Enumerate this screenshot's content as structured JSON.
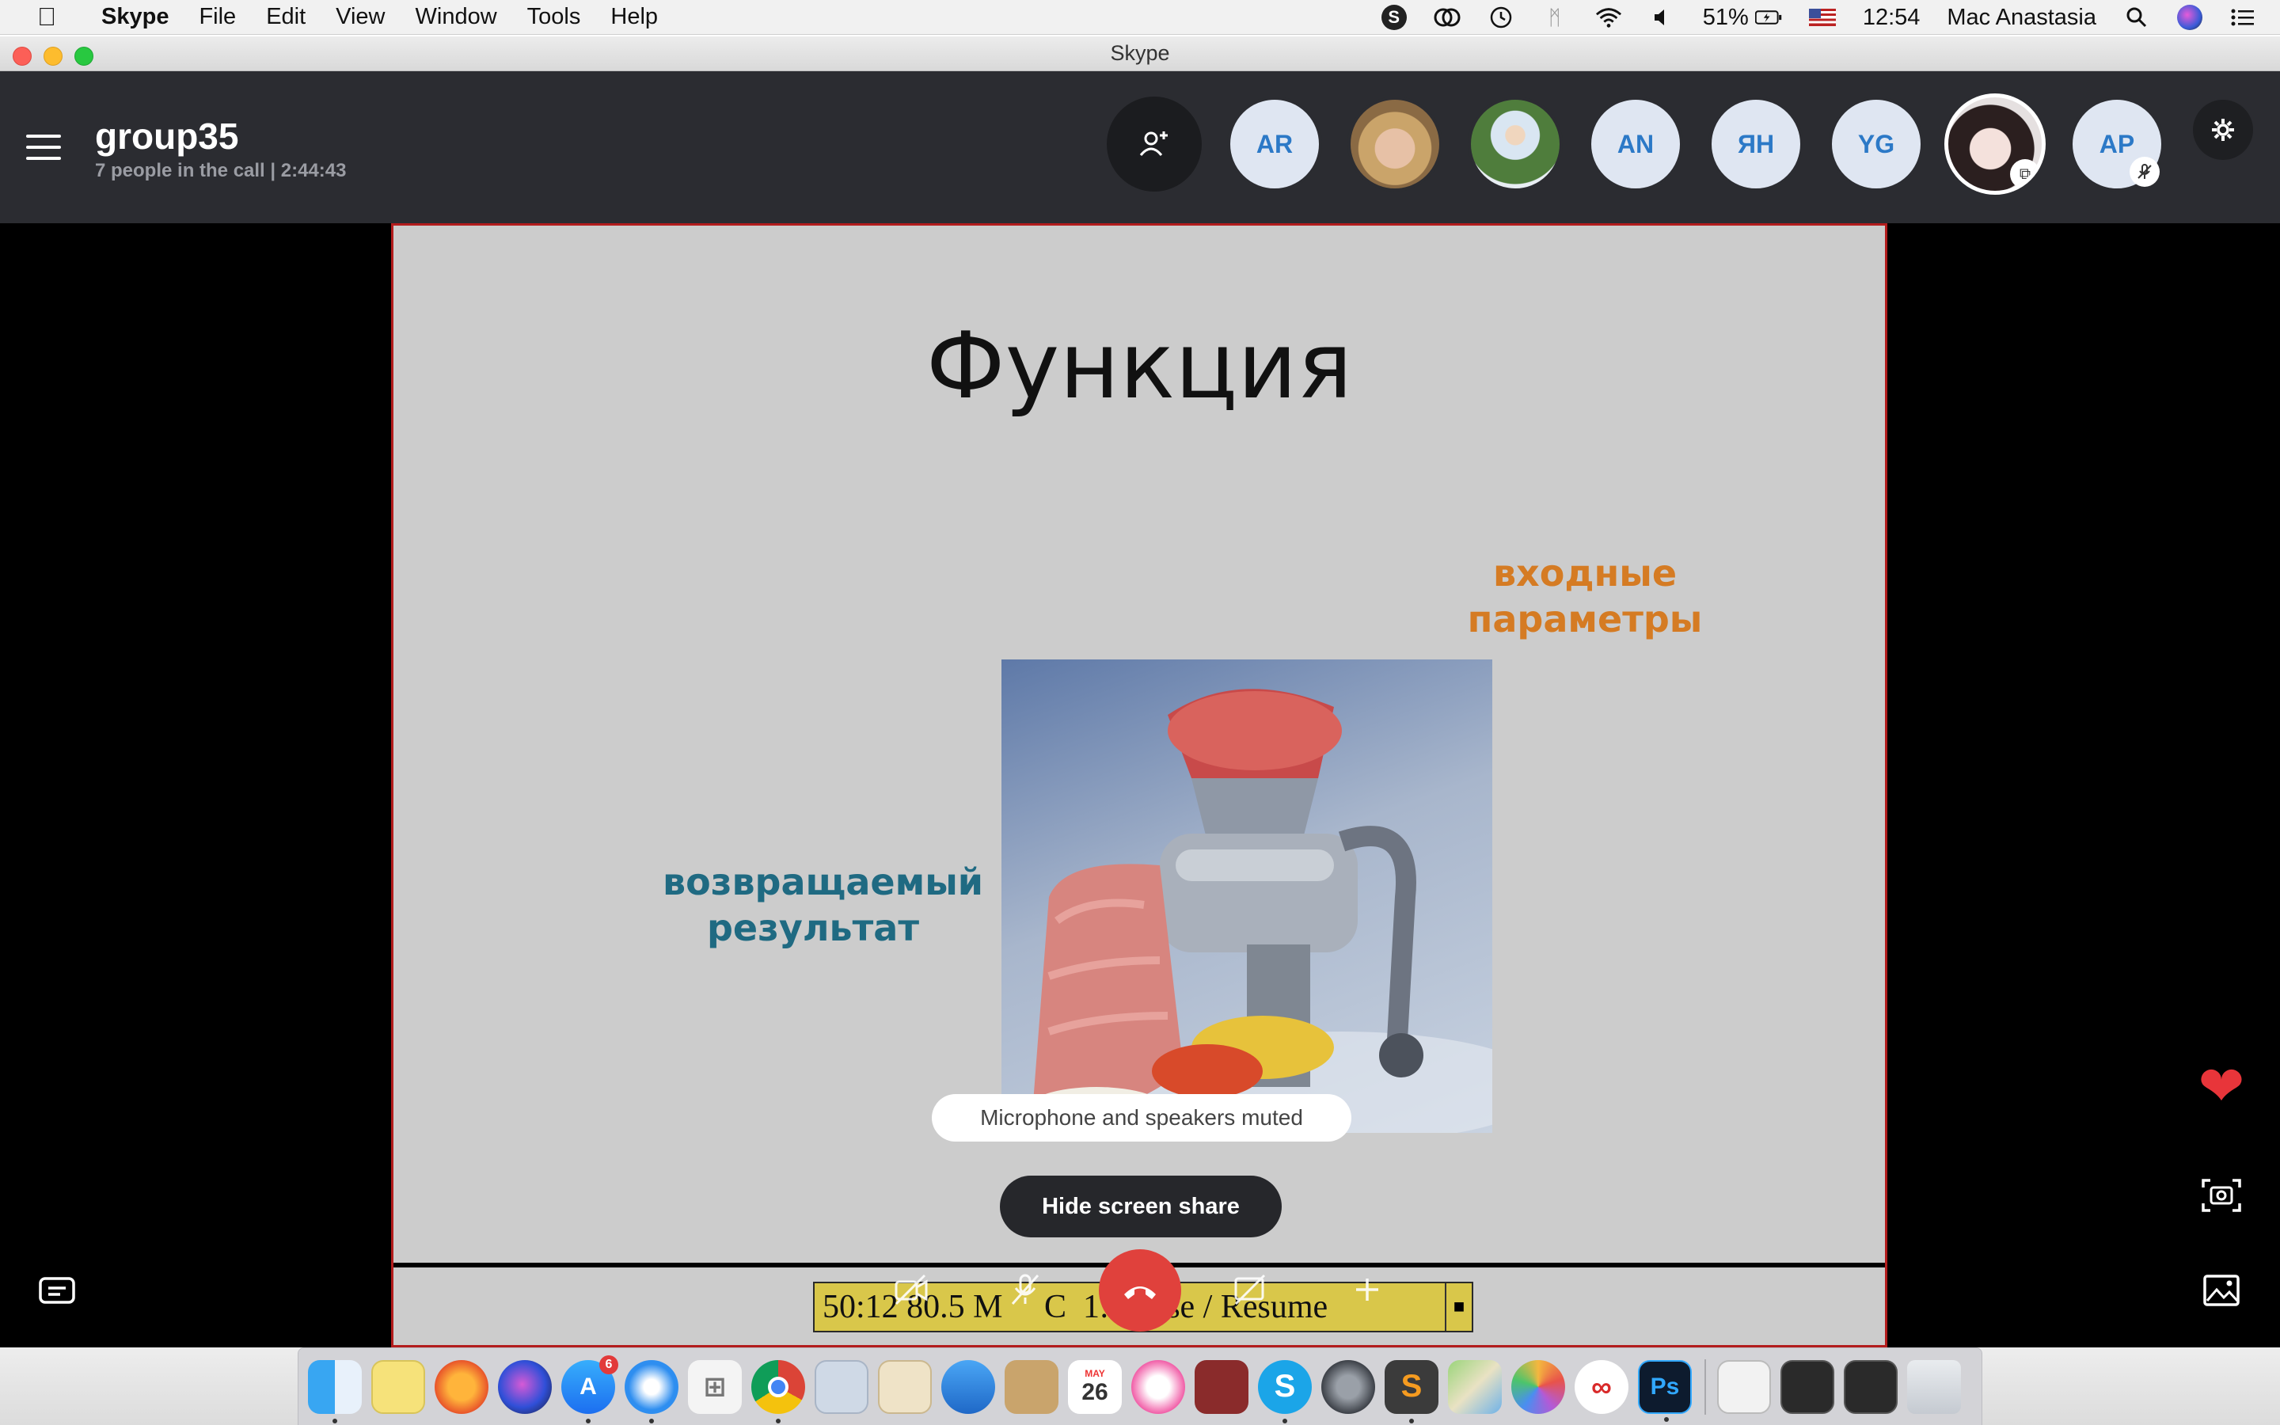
{
  "menubar": {
    "app_name": "Skype",
    "menus": [
      "File",
      "Edit",
      "View",
      "Window",
      "Tools",
      "Help"
    ],
    "battery": "51%",
    "time": "12:54",
    "user": "Mac Anastasia"
  },
  "window": {
    "title": "Skype"
  },
  "call": {
    "group_name": "group35",
    "status": "7 people in the call | 2:44:43",
    "participants": [
      {
        "kind": "add",
        "icon": "add-person-icon"
      },
      {
        "kind": "initials",
        "initials": "AR"
      },
      {
        "kind": "photo",
        "icon": "avatar-photo"
      },
      {
        "kind": "photo",
        "icon": "avatar-photo"
      },
      {
        "kind": "initials",
        "initials": "AN"
      },
      {
        "kind": "initials",
        "initials": "ЯН"
      },
      {
        "kind": "initials",
        "initials": "YG"
      },
      {
        "kind": "photo",
        "icon": "avatar-photo",
        "badge": "screen-share-icon"
      },
      {
        "kind": "initials",
        "initials": "AP",
        "badge": "mic-muted-icon"
      }
    ],
    "muted_notice": "Microphone and speakers muted",
    "hide_share_label": "Hide screen share"
  },
  "slide": {
    "title": "Функция",
    "input_label": "входные\nпараметры",
    "output_label": "возвращаемый\nрезультат"
  },
  "recorder": {
    "text": "50:12 80.5 M     C  1: Pause / Resume"
  },
  "colors": {
    "header_bg": "#2b2c31",
    "accent_blue": "#2c79c7",
    "end_call": "#e0413c",
    "share_border": "#b31d1d",
    "input_label": "#d57b23",
    "output_label": "#1f6a82"
  },
  "dock": {
    "apps": [
      "Finder",
      "Notes",
      "Firefox",
      "Siri",
      "App Store",
      "Safari",
      "Launchpad",
      "Chrome",
      "Preview",
      "Documents",
      "Migration",
      "Contacts",
      "Calendar",
      "iTunes",
      "Photo Booth",
      "Skype",
      "System Preferences",
      "Sublime Text",
      "Maps",
      "Photos",
      "Creative Cloud",
      "Photoshop"
    ],
    "calendar_month": "MAY",
    "calendar_day": "26",
    "app_store_badge": "6"
  }
}
